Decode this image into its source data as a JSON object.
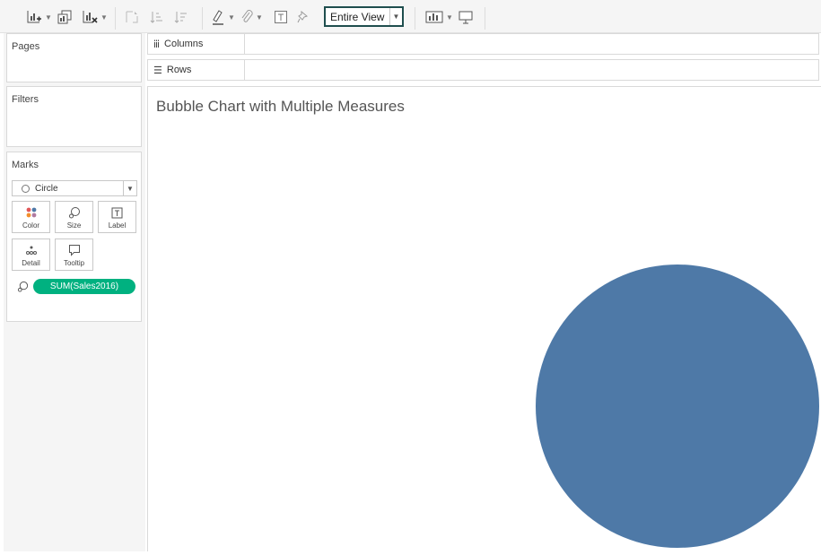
{
  "toolbar": {
    "fit_dropdown": {
      "label": "Entire View"
    },
    "icons": [
      "new-worksheet-icon",
      "duplicate-sheet-icon",
      "clear-sheet-icon",
      "swap-rows-columns-icon",
      "sort-ascending-icon",
      "sort-descending-icon",
      "highlight-icon",
      "attach-icon",
      "text-label-icon",
      "pin-icon",
      "show-me-icon",
      "presentation-icon"
    ]
  },
  "cards": {
    "pages": {
      "title": "Pages"
    },
    "filters": {
      "title": "Filters"
    },
    "marks": {
      "title": "Marks",
      "mark_type": "Circle",
      "buttons": [
        "Color",
        "Size",
        "Label",
        "Detail",
        "Tooltip"
      ],
      "pill": {
        "field": "SUM(Sales2016)",
        "encoding_icon": "size-icon",
        "color": "#00b180"
      }
    }
  },
  "shelves": {
    "columns": "Columns",
    "rows": "Rows"
  },
  "view": {
    "title": "Bubble Chart with Multiple Measures"
  },
  "chart_data": {
    "type": "scatter",
    "title": "Bubble Chart with Multiple Measures",
    "mark": "circle",
    "series": [
      {
        "size_field": "SUM(Sales2016)",
        "color": "#4e79a7"
      }
    ],
    "grid": false,
    "legend": "none"
  }
}
